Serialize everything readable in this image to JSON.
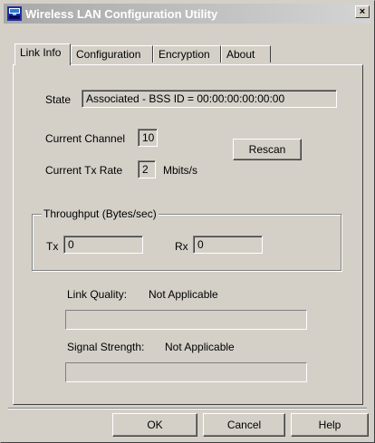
{
  "window": {
    "title": "Wireless LAN Configuration Utility",
    "close_label": "×"
  },
  "tabs": [
    {
      "label": "Link Info",
      "active": true
    },
    {
      "label": "Configuration",
      "active": false
    },
    {
      "label": "Encryption",
      "active": false
    },
    {
      "label": "About",
      "active": false
    }
  ],
  "link_info": {
    "state_label": "State",
    "state_value": "Associated - BSS ID = 00:00:00:00:00:00",
    "channel_label": "Current Channel",
    "channel_value": "10",
    "tx_rate_label": "Current Tx Rate",
    "tx_rate_value": "2",
    "tx_rate_unit": "Mbits/s",
    "rescan_label": "Rescan",
    "throughput": {
      "title": "Throughput (Bytes/sec)",
      "tx_label": "Tx",
      "tx_value": "0",
      "rx_label": "Rx",
      "rx_value": "0"
    },
    "link_quality_label": "Link Quality:",
    "link_quality_value": "Not Applicable",
    "link_quality_level": 0,
    "signal_strength_label": "Signal Strength:",
    "signal_strength_value": "Not Applicable",
    "signal_strength_level": 0
  },
  "footer": {
    "ok_label": "OK",
    "cancel_label": "Cancel",
    "help_label": "Help"
  }
}
